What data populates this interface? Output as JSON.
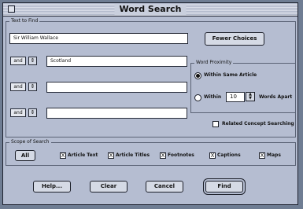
{
  "window": {
    "title": "Word Search"
  },
  "text_to_find": {
    "label": "Text to Find",
    "primary_value": "Sir William Wallace",
    "rows": [
      {
        "operator": "and",
        "value": "Scotland"
      },
      {
        "operator": "and",
        "value": ""
      },
      {
        "operator": "and",
        "value": ""
      }
    ],
    "fewer_choices_label": "Fewer Choices"
  },
  "word_proximity": {
    "label": "Word Proximity",
    "option_same_article": "Within Same Article",
    "option_within_label": "Within",
    "within_value": "10",
    "words_apart_label": "Words Apart",
    "selected": "same_article"
  },
  "related_concept": {
    "label": "Related Concept Searching",
    "checked": false
  },
  "scope": {
    "label": "Scope of Search",
    "all_button": "All",
    "checkbox_mark": "X",
    "options": [
      {
        "label": "Article Text",
        "checked": true
      },
      {
        "label": "Article Titles",
        "checked": true
      },
      {
        "label": "Footnotes",
        "checked": true
      },
      {
        "label": "Captions",
        "checked": true
      },
      {
        "label": "Maps",
        "checked": true
      }
    ]
  },
  "buttons": {
    "help": "Help...",
    "clear": "Clear",
    "cancel": "Cancel",
    "find": "Find"
  },
  "icons": {
    "operator_menu": "up-down-arrow-icon",
    "spinner": "spinner-arrows-icon"
  },
  "colors": {
    "desktop": "#6f7d93",
    "dialog": "#b5bdd1"
  }
}
